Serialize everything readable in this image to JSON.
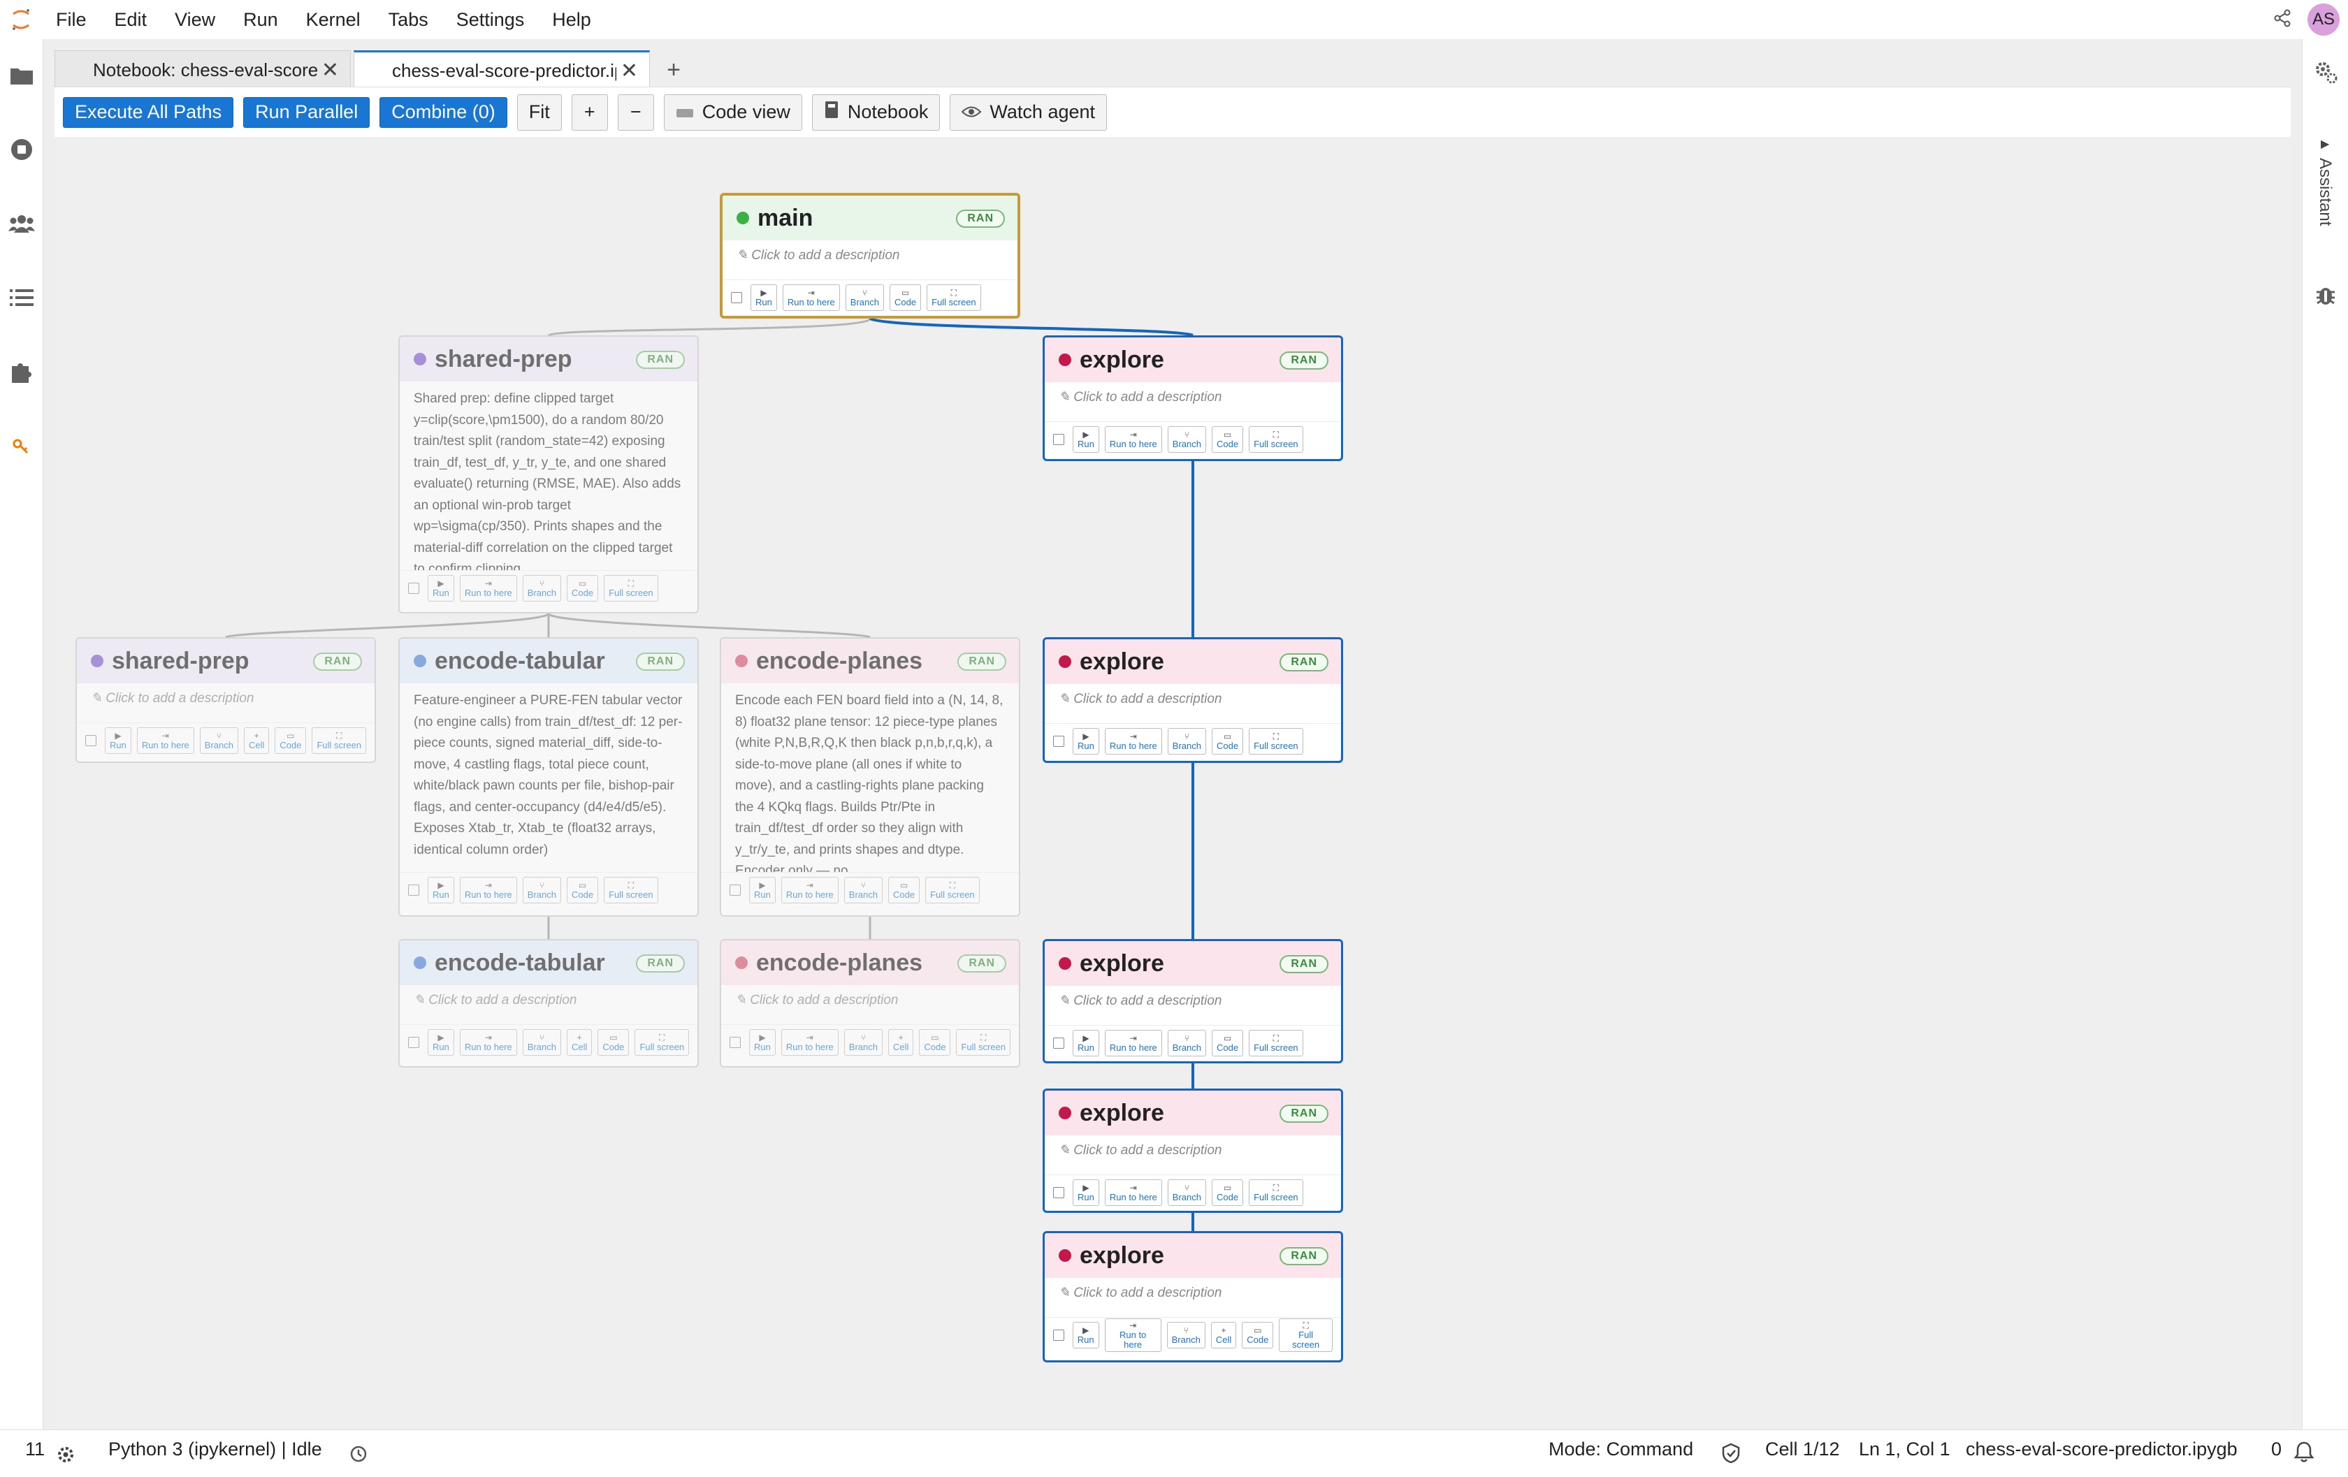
{
  "menubar": {
    "items": [
      "File",
      "Edit",
      "View",
      "Run",
      "Kernel",
      "Tabs",
      "Settings",
      "Help"
    ],
    "avatar": "AS"
  },
  "right_panel": {
    "assistant_label": "Assistant"
  },
  "tabs": [
    {
      "label": "Notebook: chess-eval-score-predictor"
    },
    {
      "label": "chess-eval-score-predictor.ipygb"
    }
  ],
  "toolbar": {
    "execute_all": "Execute All Paths",
    "run_parallel": "Run Parallel",
    "combine": "Combine (0)",
    "fit": "Fit",
    "zoom_in": "+",
    "zoom_out": "−",
    "code_view": "Code view",
    "notebook": "Notebook",
    "watch_agent": "Watch agent"
  },
  "node_buttons": {
    "run": "Run",
    "run_to_here": "Run to here",
    "branch": "Branch",
    "cell": "Cell",
    "code": "Code",
    "full_screen": "Full screen"
  },
  "placeholder": "✎ Click to add a description",
  "ran_badge": "RAN",
  "nodes": [
    {
      "title": "main",
      "color": "#3cb043",
      "header_bg": "#e8f5e9"
    },
    {
      "title": "shared-prep",
      "color": "#7a57c9",
      "header_bg": "#ede7f6",
      "description": "Shared prep: define clipped target y=clip(score,\\pm1500), do a random 80/20 train/test split (random_state=42) exposing train_df, test_df, y_tr, y_te, and one shared evaluate() returning (RMSE, MAE). Also adds an optional win-prob target wp=\\sigma(cp/350). Prints shapes and the material-diff correlation on the clipped target to confirm clipping"
    },
    {
      "title": "explore",
      "color": "#c2184b",
      "header_bg": "#fce4ec"
    },
    {
      "title": "shared-prep",
      "color": "#7a57c9",
      "header_bg": "#ede7f6"
    },
    {
      "title": "encode-tabular",
      "color": "#4a7fd6",
      "header_bg": "#e3edf9",
      "description": "Feature-engineer a PURE-FEN tabular vector (no engine calls) from train_df/test_df: 12 per-piece counts, signed material_diff, side-to-move, 4 castling flags, total piece count, white/black pawn counts per file, bishop-pair flags, and center-occupancy (d4/e4/d5/e5). Exposes Xtab_tr, Xtab_te (float32 arrays, identical column order)"
    },
    {
      "title": "encode-planes",
      "color": "#d2506b",
      "header_bg": "#fce4ec",
      "description": "Encode each FEN board field into a (N, 14, 8, 8) float32 plane tensor: 12 piece-type planes (white P,N,B,R,Q,K then black p,n,b,r,q,k), a side-to-move plane (all ones if white to move), and a castling-rights plane packing the 4 KQkq flags. Builds Ptr/Pte in train_df/test_df order so they align with y_tr/y_te, and prints shapes and dtype. Encoder only — no"
    },
    {
      "title": "explore",
      "color": "#c2184b",
      "header_bg": "#fce4ec"
    },
    {
      "title": "encode-tabular",
      "color": "#4a7fd6",
      "header_bg": "#e3edf9"
    },
    {
      "title": "encode-planes",
      "color": "#d2506b",
      "header_bg": "#fce4ec"
    },
    {
      "title": "explore",
      "color": "#c2184b",
      "header_bg": "#fce4ec"
    },
    {
      "title": "explore",
      "color": "#c2184b",
      "header_bg": "#fce4ec"
    },
    {
      "title": "explore",
      "color": "#c2184b",
      "header_bg": "#fce4ec"
    }
  ],
  "statusbar": {
    "count": "11",
    "kernel": "Python 3 (ipykernel) | Idle",
    "mode": "Mode: Command",
    "cell": "Cell 1/12",
    "position": "Ln 1, Col 1",
    "filename": "chess-eval-score-predictor.ipygb",
    "notifications": "0"
  }
}
